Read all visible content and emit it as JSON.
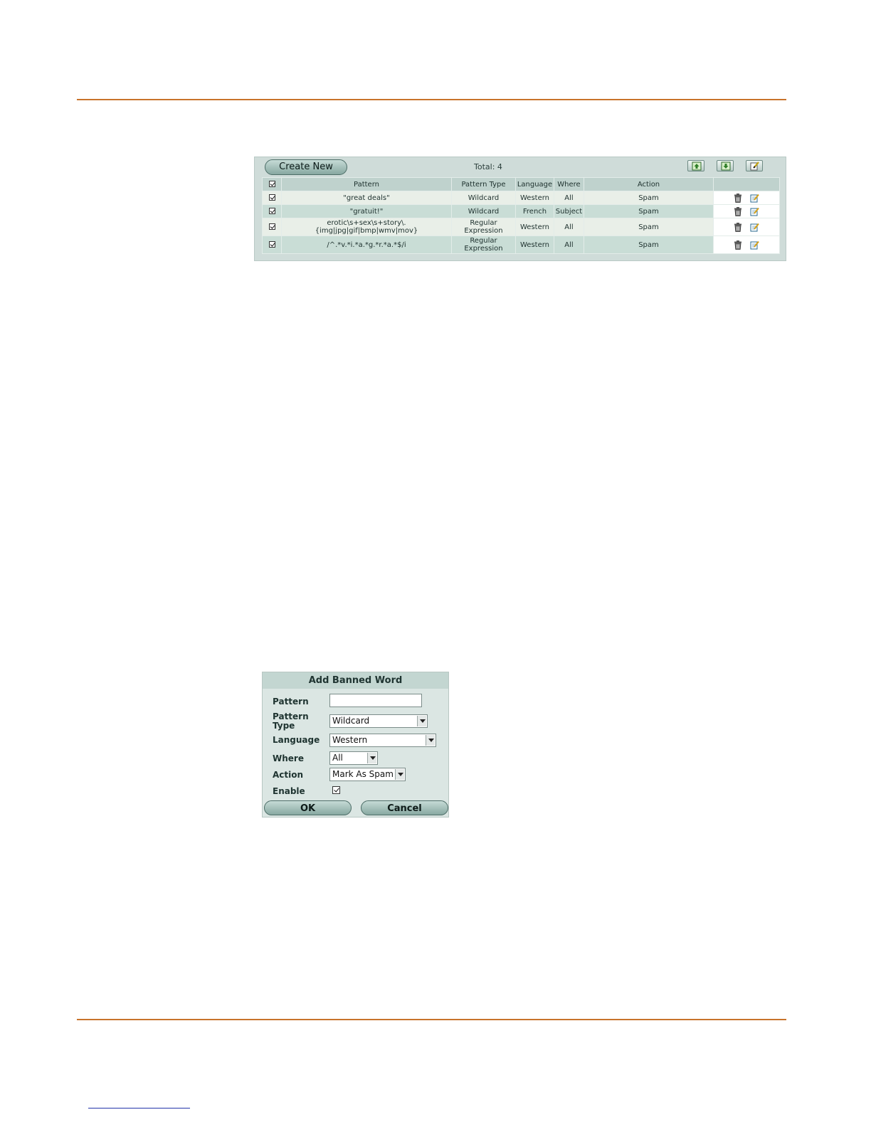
{
  "list_panel": {
    "create_new_label": "Create New",
    "total_text": "Total: 4",
    "toolbar_icons": [
      "import-icon",
      "export-icon",
      "clear-icon"
    ],
    "columns": [
      "Pattern",
      "Pattern Type",
      "Language",
      "Where",
      "Action"
    ],
    "rows": [
      {
        "pattern": "\"great deals\"",
        "pattern_type": "Wildcard",
        "language": "Western",
        "where": "All",
        "action": "Spam"
      },
      {
        "pattern": "\"gratuit!\"",
        "pattern_type": "Wildcard",
        "language": "French",
        "where": "Subject",
        "action": "Spam"
      },
      {
        "pattern": "erotic\\s+sex\\s+story\\.",
        "pattern_line2": "{img|jpg|gif|bmp|wmv|mov}",
        "pattern_type": "Regular",
        "pattern_type_line2": "Expression",
        "language": "Western",
        "where": "All",
        "action": "Spam"
      },
      {
        "pattern": "/^.*v.*i.*a.*g.*r.*a.*$/i",
        "pattern_type": "Regular",
        "pattern_type_line2": "Expression",
        "language": "Western",
        "where": "All",
        "action": "Spam"
      }
    ],
    "row_icons": [
      "delete-icon",
      "edit-icon"
    ]
  },
  "dialog": {
    "title": "Add Banned Word",
    "pattern_label": "Pattern",
    "pattern_value": "",
    "pattern_type_label_1": "Pattern",
    "pattern_type_label_2": "Type",
    "pattern_type_value": "Wildcard",
    "language_label": "Language",
    "language_value": "Western",
    "where_label": "Where",
    "where_value": "All",
    "action_label": "Action",
    "action_value": "Mark As Spam",
    "enable_label": "Enable",
    "enable_checked": true,
    "ok_label": "OK",
    "cancel_label": "Cancel"
  },
  "colors": {
    "rule": "#c8732b",
    "panel_bg": "#cfdcd9",
    "button": "#87a8a1"
  }
}
